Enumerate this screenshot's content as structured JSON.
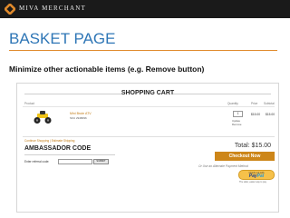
{
  "header": {
    "brand": "MIVA MERCHANT",
    "logo_icon": "miva-logo-icon"
  },
  "slide": {
    "title": "BASKET PAGE",
    "subtitle": "Minimize other actionable items (e.g. Remove button)",
    "accent_color": "#2e76b6",
    "rule_color": "#e08a2c"
  },
  "cart": {
    "heading": "SHOPPING CART",
    "columns": {
      "product": "Product",
      "quantity": "Quantity",
      "price": "Price",
      "subtotal": "Subtotal"
    },
    "item": {
      "name": "Mini Brute ATV",
      "sku": "SKU 2948096",
      "quantity": "1",
      "update_label": "Update",
      "remove_label": "Remove",
      "price": "$15.00",
      "subtotal": "$15.00"
    },
    "shipping_text": "Continue Shopping | Estimate Shipping",
    "ambassador_heading": "AMBASSADOR CODE",
    "referral_label": "Enter referral code:",
    "referral_value": "",
    "submit_label": "SUBMIT",
    "total": "Total: $15.00",
    "checkout_label": "Checkout Now",
    "alt_payment": "Or Use an Alternate Payment Method",
    "paypal": {
      "check_out_with": "Check out with",
      "pay": "Pay",
      "pal": "Pal",
      "tagline": "The safer, easier way to pay"
    },
    "checkout_color": "#cd8619"
  }
}
